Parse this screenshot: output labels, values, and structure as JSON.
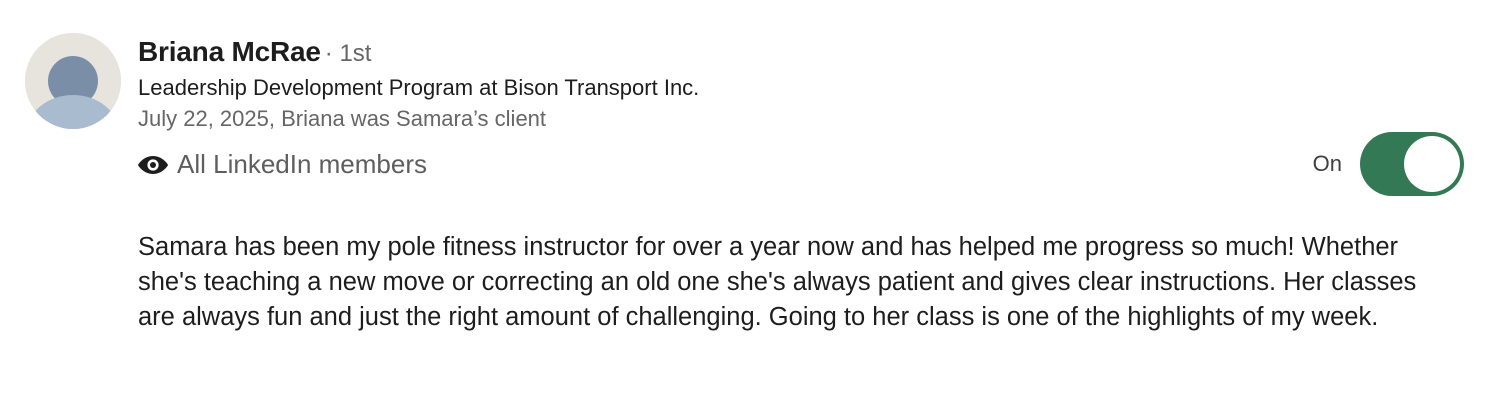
{
  "recommendation": {
    "author": {
      "name": "Briana McRae",
      "degree": "· 1st",
      "headline": "Leadership Development Program at Bison Transport Inc.",
      "meta": "July 22, 2025, Briana was Samara’s client"
    },
    "visibility": {
      "icon": "eye-icon",
      "label": "All LinkedIn members"
    },
    "toggle": {
      "label": "On",
      "state": "on",
      "color": "#347956"
    },
    "text": "Samara has been my pole fitness instructor for over a year now and has helped me progress so much! Whether she's teaching a new move or correcting an old one she's always patient and gives clear instructions. Her classes are always fun and just the right amount of challenging. Going to her class is one of the highlights of my week."
  }
}
